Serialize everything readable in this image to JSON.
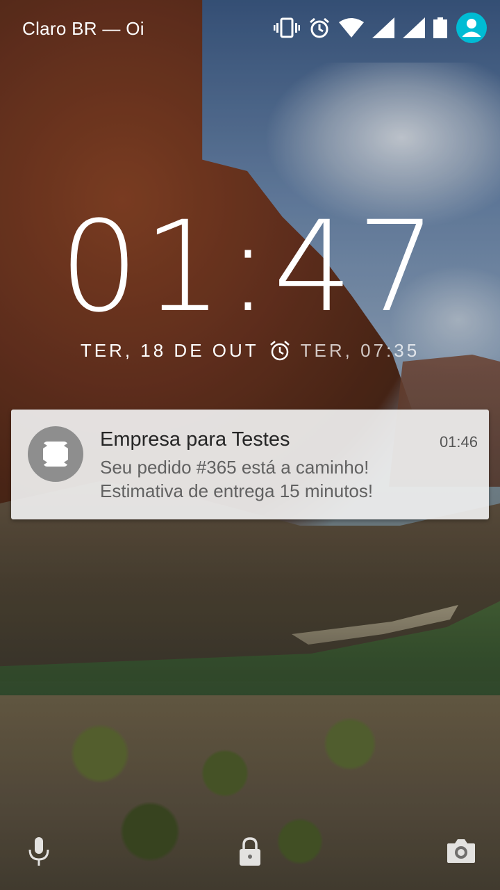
{
  "status_bar": {
    "carrier": "Claro BR — Oi",
    "icons": [
      "vibrate-icon",
      "alarm-icon",
      "wifi-icon",
      "signal-icon",
      "signal-icon",
      "battery-icon",
      "user-avatar-icon"
    ],
    "accent_color": "#00bcd4"
  },
  "lock": {
    "time": "01:47",
    "date": "TER, 18 DE OUT",
    "next_alarm": "TER, 07:35"
  },
  "notification": {
    "app_title": "Empresa para Testes",
    "time": "01:46",
    "line1": "Seu pedido #365 está a caminho!",
    "line2": "Estimativa de entrega 15 minutos!"
  },
  "bottom_actions": {
    "left_icon": "microphone-icon",
    "center_icon": "lock-icon",
    "right_icon": "camera-icon"
  }
}
